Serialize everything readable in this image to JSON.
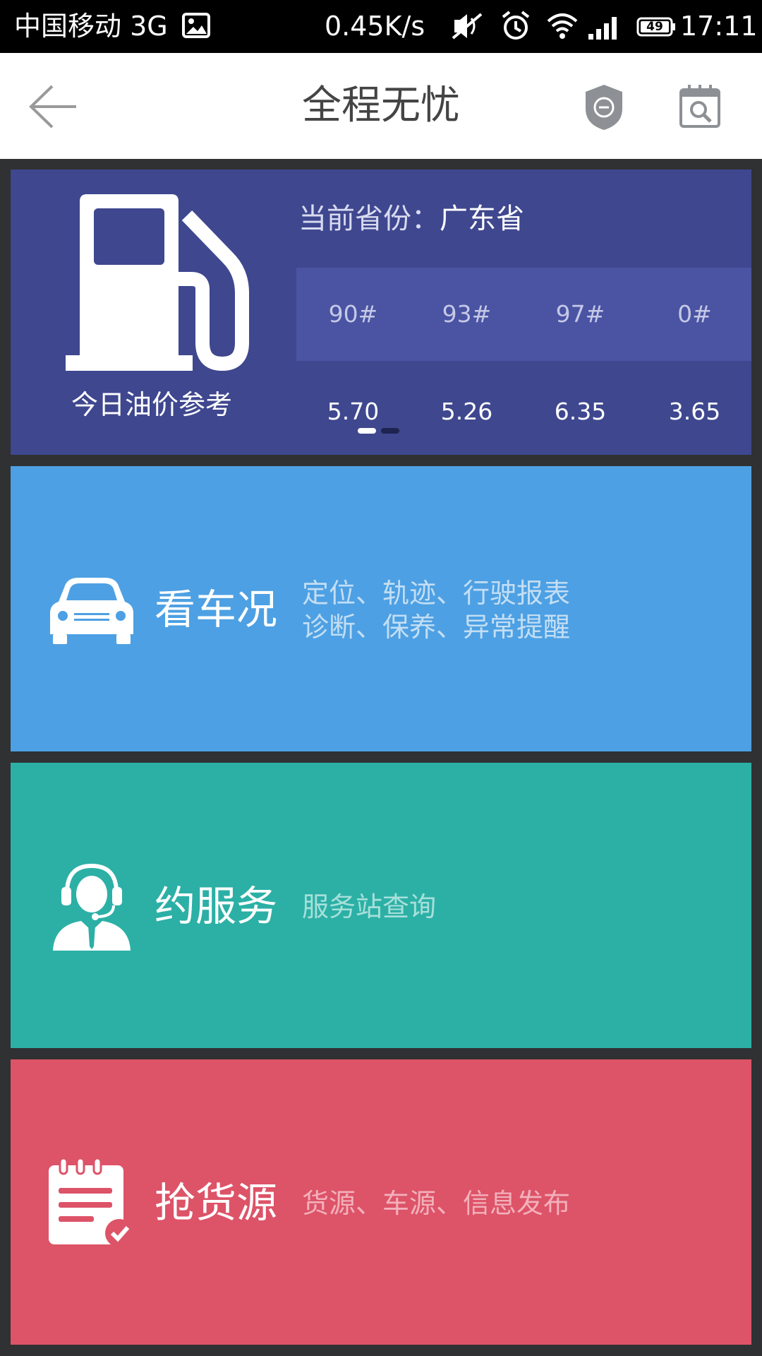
{
  "status_bar": {
    "carrier": "中国移动 3G",
    "net_speed": "0.45K/s",
    "battery": "49",
    "time": "17:11",
    "icons": [
      "image-icon",
      "mute-icon",
      "alarm-icon",
      "wifi-icon",
      "signal-icon",
      "battery-icon"
    ]
  },
  "header": {
    "title": "全程无忧",
    "icons": [
      "back-arrow-icon",
      "shield-icon",
      "calendar-search-icon"
    ]
  },
  "oil_price": {
    "caption": "今日油价参考",
    "province_label": "当前省份：",
    "province": "广东省",
    "grades": [
      "90#",
      "93#",
      "97#",
      "0#"
    ],
    "prices": [
      "5.70",
      "5.26",
      "6.35",
      "3.65"
    ],
    "page_count": 2,
    "active_page": 1,
    "icon": "fuel-pump-icon"
  },
  "cards": [
    {
      "title": "看车况",
      "desc_lines": [
        "定位、轨迹、行驶报表",
        "诊断、保养、异常提醒"
      ],
      "icon": "car-icon",
      "color": "#4da0e3"
    },
    {
      "title": "约服务",
      "desc_lines": [
        "服务站查询"
      ],
      "icon": "service-agent-icon",
      "color": "#2cb0a6"
    },
    {
      "title": "抢货源",
      "desc_lines": [
        "货源、车源、信息发布"
      ],
      "icon": "checklist-icon",
      "color": "#dd5368"
    }
  ],
  "colors": {
    "background": "#2f3133",
    "oil_card": "#3f478f",
    "grade_band": "#4a54a3"
  }
}
